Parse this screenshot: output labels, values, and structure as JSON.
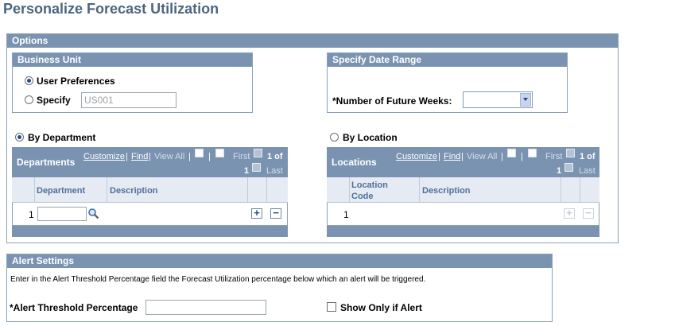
{
  "page": {
    "title": "Personalize Forecast Utilization"
  },
  "options": {
    "header": "Options",
    "business_unit": {
      "header": "Business Unit",
      "user_preferences_label": "User Preferences",
      "specify_label": "Specify",
      "specify_value": "US001",
      "selected": "user_preferences"
    },
    "date_range": {
      "header": "Specify Date Range",
      "weeks_label": "*Number of Future Weeks:",
      "weeks_value": ""
    },
    "by_department_label": "By Department",
    "by_location_label": "By Location",
    "selected_mode": "by_department",
    "departments_grid": {
      "title": "Departments",
      "customize": "Customize",
      "find": "Find",
      "view_all": "View All",
      "sep": "|",
      "first": "First",
      "range": "1 of",
      "count": "1",
      "last": "Last",
      "columns": [
        "Department",
        "Description"
      ],
      "rows": [
        {
          "num": "1",
          "department": "",
          "description": ""
        }
      ]
    },
    "locations_grid": {
      "title": "Locations",
      "customize": "Customize",
      "find": "Find",
      "view_all": "View All",
      "sep": "|",
      "first": "First",
      "range": "1 of",
      "count": "1",
      "last": "Last",
      "columns": [
        "Location Code",
        "Description"
      ],
      "col1_line1": "Location",
      "col1_line2": "Code",
      "rows": [
        {
          "num": "1",
          "location": "",
          "description": ""
        }
      ]
    }
  },
  "alert": {
    "header": "Alert Settings",
    "instructions": "Enter in the Alert Threshold Percentage field the Forecast Utilization percentage below which an alert will be triggered.",
    "threshold_label": "*Alert Threshold Percentage",
    "threshold_value": "",
    "show_only_label": "Show Only if Alert",
    "show_only_checked": false
  },
  "icons": {
    "add": "+",
    "remove": "−",
    "prev": "◀",
    "next": "▶",
    "lookup": "magnifier-icon",
    "zoom_view": "new-window-icon",
    "download": "grid-download-icon"
  },
  "colors": {
    "title": "#4d6580",
    "header_bar": "#7a93b1",
    "link": "#4d6f9e"
  }
}
